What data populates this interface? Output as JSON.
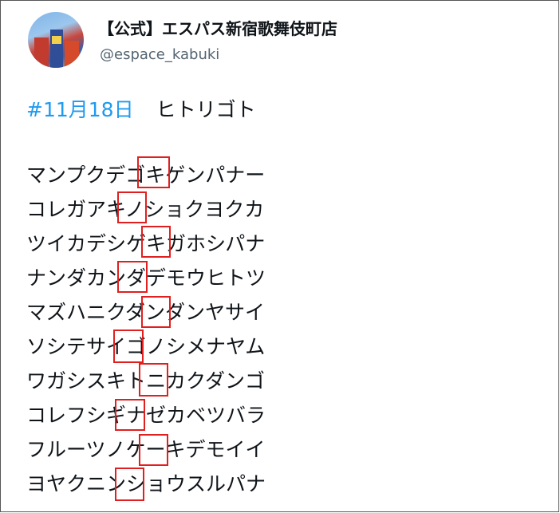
{
  "user": {
    "display_name": "【公式】エスパス新宿歌舞伎町店",
    "handle": "@espace_kabuki",
    "avatar_icon": "store-photo-avatar"
  },
  "tweet": {
    "hashtag": "#11月18日",
    "head_text": "ヒトリゴト",
    "lines": [
      "マンプクデゴキゲンパナー",
      "コレガアキノショクヨクカ",
      "ツイカデシゲキガホシパナ",
      "ナンダカンダデモウヒトツ",
      "マズハニクダンダンヤサイ",
      "ソシテサイゴノシメナヤム",
      "ワガシスキトニカクダンゴ",
      "コレフシギナゼカベツバラ",
      "フルーツノケーキデモイイ",
      "ヨヤクニンショウスルパナ"
    ]
  },
  "annotation": {
    "highlight_color": "#e02020"
  }
}
